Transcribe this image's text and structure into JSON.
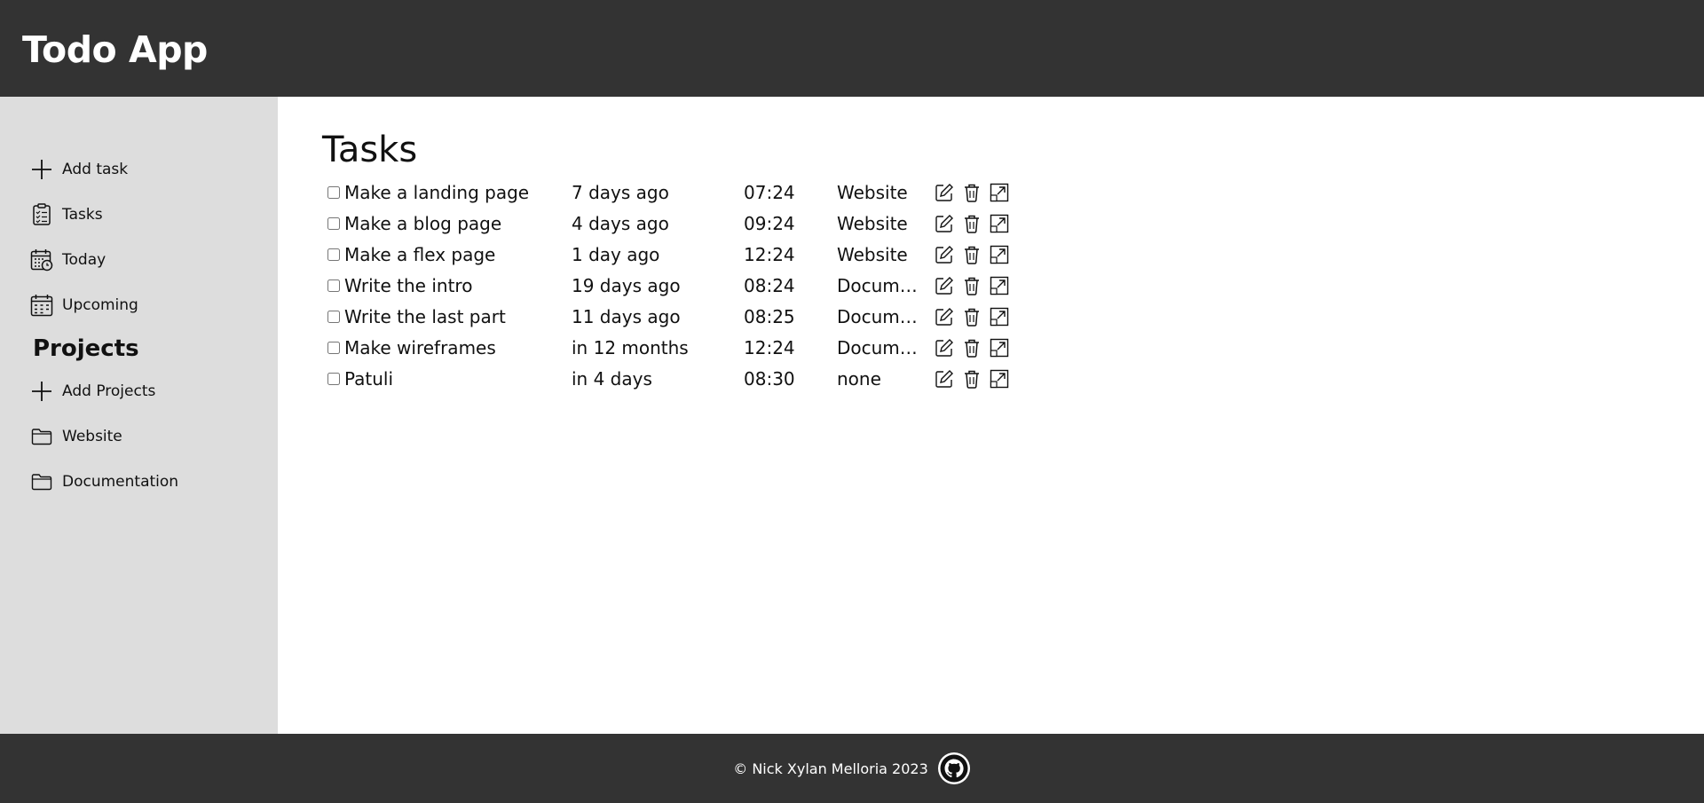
{
  "app": {
    "title": "Todo App"
  },
  "sidebar": {
    "items": [
      {
        "label": "Add task",
        "icon": "plus-icon"
      },
      {
        "label": "Tasks",
        "icon": "clipboard-list-icon"
      },
      {
        "label": "Today",
        "icon": "calendar-clock-icon"
      },
      {
        "label": "Upcoming",
        "icon": "calendar-icon"
      }
    ],
    "projects_heading": "Projects",
    "project_items": [
      {
        "label": "Add Projects",
        "icon": "plus-icon"
      },
      {
        "label": "Website",
        "icon": "folder-icon"
      },
      {
        "label": "Documentation",
        "icon": "folder-icon"
      }
    ]
  },
  "main": {
    "title": "Tasks",
    "tasks": [
      {
        "name": "Make a landing page",
        "due": "7 days ago",
        "time": "07:24",
        "project": "Website",
        "done": false
      },
      {
        "name": "Make a blog page",
        "due": "4 days ago",
        "time": "09:24",
        "project": "Website",
        "done": false
      },
      {
        "name": "Make a flex page",
        "due": "1 day ago",
        "time": "12:24",
        "project": "Website",
        "done": false
      },
      {
        "name": "Write the intro",
        "due": "19 days ago",
        "time": "08:24",
        "project": "Documentation",
        "done": false
      },
      {
        "name": "Write the last part",
        "due": "11 days ago",
        "time": "08:25",
        "project": "Documentation",
        "done": false
      },
      {
        "name": "Make wireframes",
        "due": "in 12 months",
        "time": "12:24",
        "project": "Documentation",
        "done": false
      },
      {
        "name": "Patuli",
        "due": "in 4 days",
        "time": "08:30",
        "project": "none",
        "done": false
      }
    ],
    "row_actions": [
      "edit-icon",
      "trash-icon",
      "open-details-icon"
    ]
  },
  "footer": {
    "copyright": "© Nick Xylan Melloria 2023",
    "icon": "github-icon"
  },
  "colors": {
    "header_bg": "#333333",
    "sidebar_bg": "#dddddd",
    "content_bg": "#ffffff",
    "text": "#111111"
  }
}
